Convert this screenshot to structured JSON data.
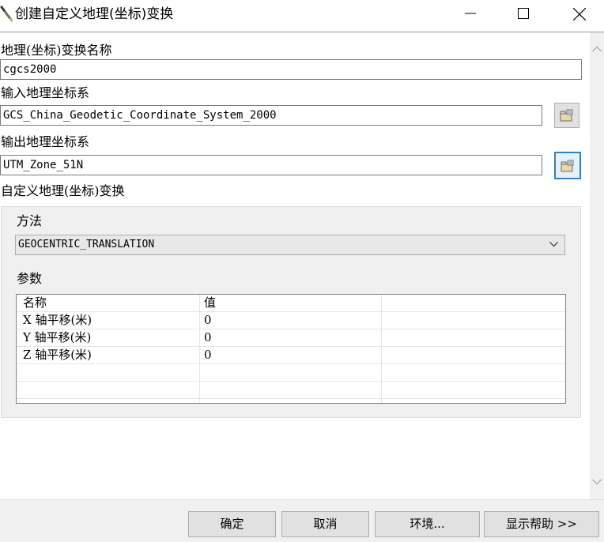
{
  "window": {
    "title": "创建自定义地理(坐标)变换",
    "title_icon": "pencil-icon",
    "controls": [
      "minimize-icon",
      "maximize-icon",
      "close-icon"
    ]
  },
  "form": {
    "transform_name_label": "地理(坐标)变换名称",
    "transform_name_value": "cgcs2000",
    "input_gcs_label": "输入地理坐标系",
    "input_gcs_value": "GCS_China_Geodetic_Coordinate_System_2000",
    "output_gcs_label": "输出地理坐标系",
    "output_gcs_value": "UTM_Zone_51N",
    "custom_transform_label": "自定义地理(坐标)变换",
    "browse_icon": "folder-browse-icon"
  },
  "custom_transform": {
    "method_label": "方法",
    "method_value": "GEOCENTRIC_TRANSLATION",
    "params_label": "参数",
    "params_table": {
      "columns": [
        "名称",
        "值",
        ""
      ],
      "rows": [
        {
          "name": "X 轴平移(米)",
          "value": "0"
        },
        {
          "name": "Y 轴平移(米)",
          "value": "0"
        },
        {
          "name": "Z 轴平移(米)",
          "value": "0"
        }
      ]
    }
  },
  "footer": {
    "ok": "确定",
    "cancel": "取消",
    "environments": "环境...",
    "show_help": "显示帮助 >>"
  },
  "colors": {
    "panel_background": "#f0f0f0",
    "focus_border": "#3c7fb1",
    "button_face": "#e1e1e1"
  }
}
